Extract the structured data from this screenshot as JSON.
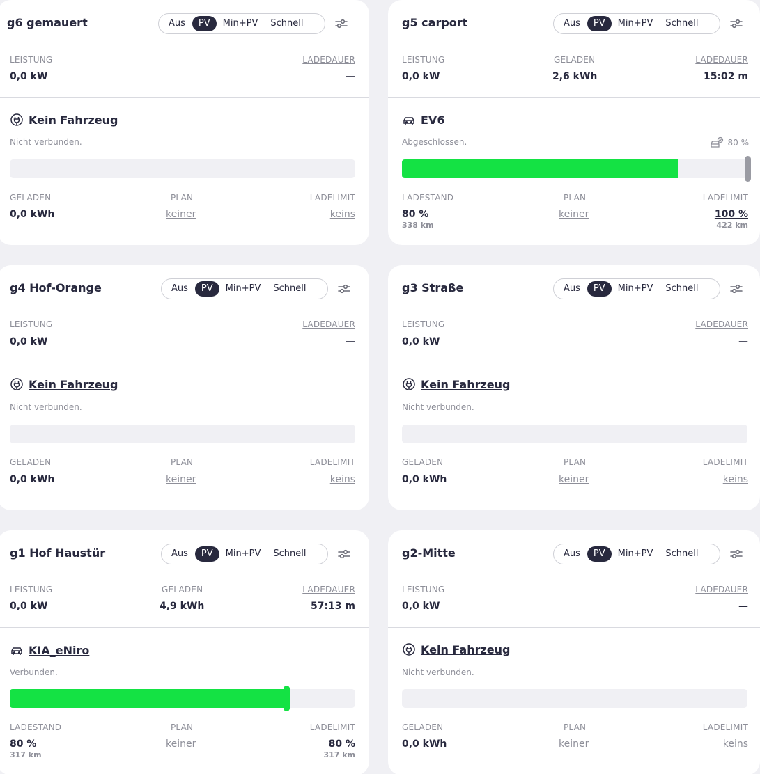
{
  "modes": [
    "Aus",
    "PV",
    "Min+PV",
    "Schnell"
  ],
  "labels": {
    "leistung": "LEISTUNG",
    "geladen": "GELADEN",
    "ladedauer": "LADEDAUER",
    "plan": "PLAN",
    "ladelimit": "LADELIMIT",
    "ladestand": "LADESTAND"
  },
  "colors": {
    "charge": "#14e244",
    "dark": "#28293e",
    "muted": "#8e8f99",
    "background": "#f0f0f4"
  },
  "loadpoints": [
    {
      "title": "g6 gemauert",
      "active_mode": "PV",
      "leistung": "0,0 kW",
      "ladedauer": "—",
      "vehicle": {
        "icon": "plug-icon",
        "name": "Kein Fahrzeug",
        "status": "Nicht verbunden."
      },
      "geladen": "0,0 kWh",
      "plan": "keiner",
      "ladelimit": "keins"
    },
    {
      "title": "g5 carport",
      "active_mode": "PV",
      "leistung": "0,0 kW",
      "geladen_top": "2,6 kWh",
      "ladedauer": "15:02 m",
      "vehicle": {
        "icon": "car-icon",
        "name": "EV6",
        "status": "Abgeschlossen."
      },
      "vehicle_limit": "80 %",
      "soc_percent": 80,
      "limit_percent": 100,
      "ladestand": "80 %",
      "ladestand_range": "338 km",
      "plan": "keiner",
      "ladelimit": "100 %",
      "ladelimit_range": "422 km"
    },
    {
      "title": "g4 Hof-Orange",
      "active_mode": "PV",
      "leistung": "0,0 kW",
      "ladedauer": "—",
      "vehicle": {
        "icon": "plug-icon",
        "name": "Kein Fahrzeug",
        "status": "Nicht verbunden."
      },
      "geladen": "0,0 kWh",
      "plan": "keiner",
      "ladelimit": "keins"
    },
    {
      "title": "g3 Straße",
      "active_mode": "PV",
      "leistung": "0,0 kW",
      "ladedauer": "—",
      "vehicle": {
        "icon": "plug-icon",
        "name": "Kein Fahrzeug",
        "status": "Nicht verbunden."
      },
      "geladen": "0,0 kWh",
      "plan": "keiner",
      "ladelimit": "keins"
    },
    {
      "title": "g1 Hof Haustür",
      "active_mode": "PV",
      "leistung": "0,0 kW",
      "geladen_top": "4,9 kWh",
      "ladedauer": "57:13 m",
      "vehicle": {
        "icon": "car-icon",
        "name": "KIA_eNiro",
        "status": "Verbunden."
      },
      "soc_percent": 80,
      "limit_percent": 80,
      "ladestand": "80 %",
      "ladestand_range": "317 km",
      "plan": "keiner",
      "ladelimit": "80 %",
      "ladelimit_range": "317 km"
    },
    {
      "title": "g2-Mitte",
      "active_mode": "PV",
      "leistung": "0,0 kW",
      "ladedauer": "—",
      "vehicle": {
        "icon": "plug-icon",
        "name": "Kein Fahrzeug",
        "status": "Nicht verbunden."
      },
      "geladen": "0,0 kWh",
      "plan": "keiner",
      "ladelimit": "keins"
    }
  ]
}
